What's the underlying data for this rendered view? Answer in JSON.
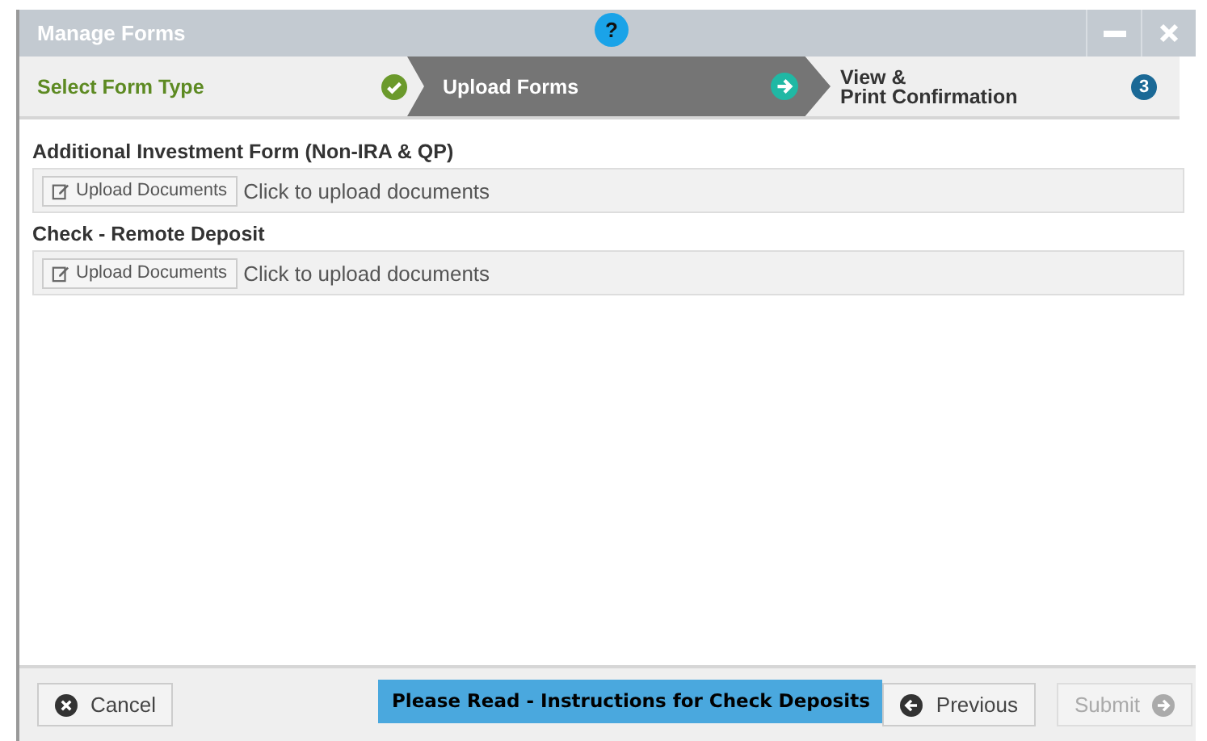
{
  "window": {
    "title": "Manage Forms",
    "help_icon": "?"
  },
  "steps": [
    {
      "label": "Select Form Type",
      "kind": "done"
    },
    {
      "label": "Upload Forms",
      "kind": "current"
    },
    {
      "label": "View &\nPrint Confirmation",
      "kind": "upcoming",
      "number": "3"
    }
  ],
  "forms": [
    {
      "title": "Additional Investment Form (Non-IRA & QP)",
      "button": "Upload Documents",
      "hint": "Click to upload documents"
    },
    {
      "title": "Check - Remote Deposit",
      "button": "Upload Documents",
      "hint": "Click to upload documents"
    }
  ],
  "footer": {
    "cancel": {
      "label": "Cancel",
      "disabled": false
    },
    "notice": "Please Read - Instructions for Check Deposits",
    "previous": {
      "label": "Previous",
      "disabled": false
    },
    "submit": {
      "label": "Submit",
      "disabled": true
    }
  }
}
